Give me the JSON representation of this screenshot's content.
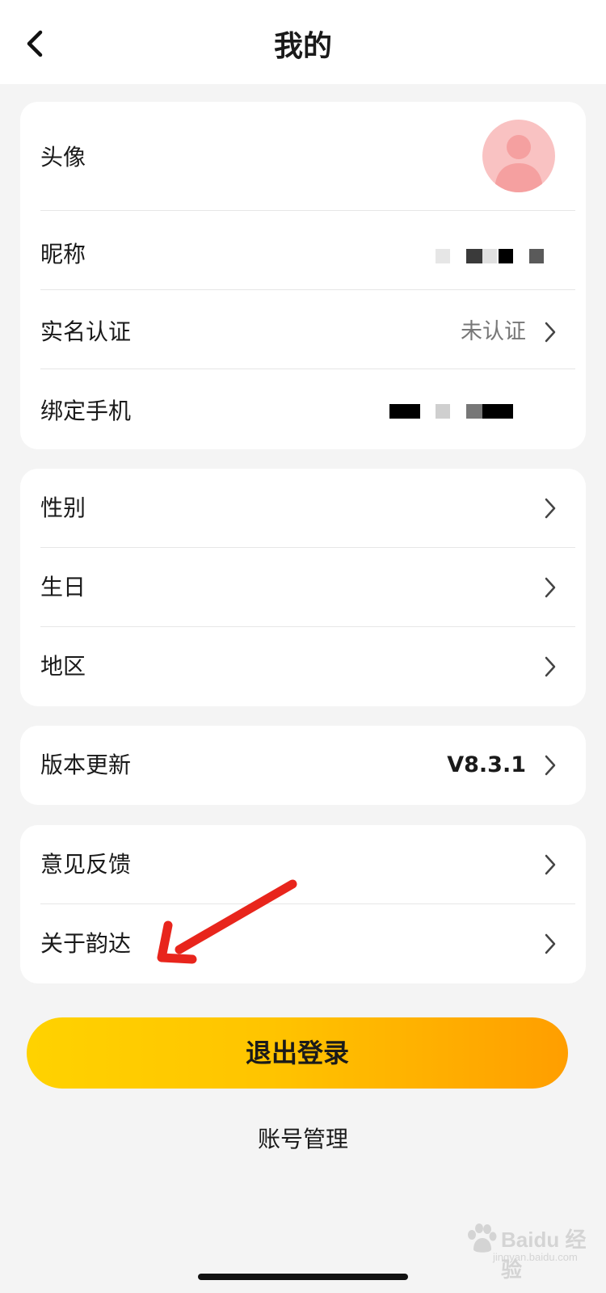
{
  "header": {
    "title": "我的",
    "back_icon": "chevron-left-icon"
  },
  "profile_section": {
    "avatar_label": "头像",
    "avatar_icon": "user-avatar-icon",
    "nickname_label": "昵称",
    "real_name_label": "实名认证",
    "real_name_value": "未认证",
    "phone_label": "绑定手机"
  },
  "info_section": {
    "gender_label": "性别",
    "birthday_label": "生日",
    "region_label": "地区"
  },
  "version_section": {
    "update_label": "版本更新",
    "version_value": "V8.3.1"
  },
  "about_section": {
    "feedback_label": "意见反馈",
    "about_label": "关于韵达"
  },
  "actions": {
    "logout_label": "退出登录",
    "account_manage_label": "账号管理"
  },
  "watermark": {
    "brand": "Baidu 经验",
    "url": "jingyan.baidu.com"
  },
  "colors": {
    "accent_start": "#ffd200",
    "accent_end": "#ff9e00",
    "annotation_arrow": "#e8251c",
    "avatar_bg": "#f9c2c2"
  }
}
